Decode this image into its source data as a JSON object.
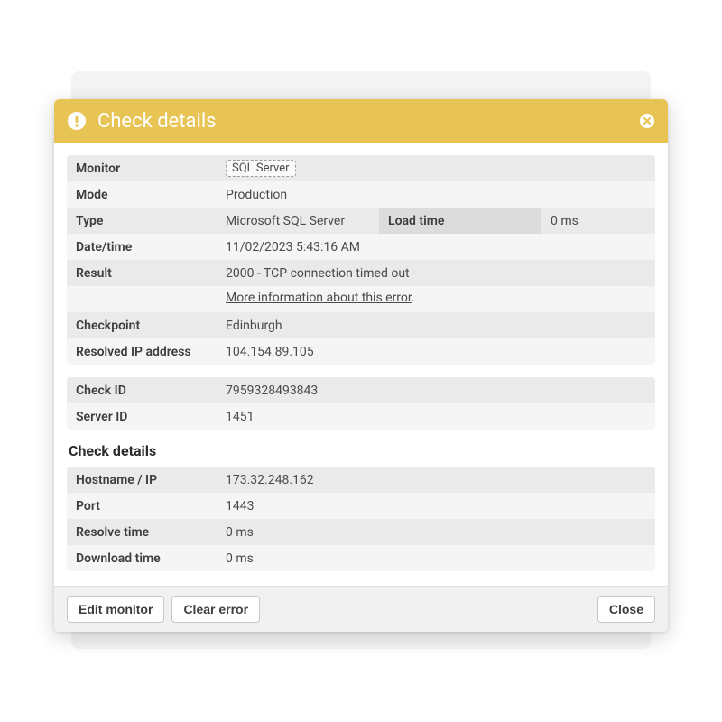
{
  "header": {
    "title": "Check details"
  },
  "summary": {
    "monitor_label": "Monitor",
    "monitor_value": "SQL Server",
    "mode_label": "Mode",
    "mode_value": "Production",
    "type_label": "Type",
    "type_value": "Microsoft SQL Server",
    "loadtime_label": "Load time",
    "loadtime_value": "0 ms",
    "datetime_label": "Date/time",
    "datetime_value": "11/02/2023 5:43:16 AM",
    "result_label": "Result",
    "result_value": "2000 - TCP connection timed out",
    "result_moreinfo": "More information about this error",
    "checkpoint_label": "Checkpoint",
    "checkpoint_value": "Edinburgh",
    "resolvedip_label": "Resolved IP address",
    "resolvedip_value": "104.154.89.105"
  },
  "ids": {
    "checkid_label": "Check ID",
    "checkid_value": "7959328493843",
    "serverid_label": "Server ID",
    "serverid_value": "1451"
  },
  "details": {
    "heading": "Check details",
    "hostname_label": "Hostname / IP",
    "hostname_value": "173.32.248.162",
    "port_label": "Port",
    "port_value": "1443",
    "resolvetime_label": "Resolve time",
    "resolvetime_value": "0 ms",
    "downloadtime_label": "Download time",
    "downloadtime_value": "0 ms"
  },
  "footer": {
    "edit": "Edit monitor",
    "clear": "Clear error",
    "close": "Close"
  }
}
